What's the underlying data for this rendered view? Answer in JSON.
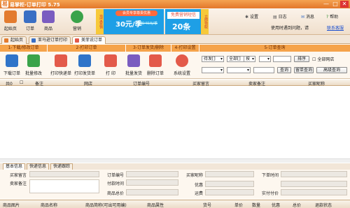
{
  "app": {
    "title": "易掌柜-订单打印 5.75",
    "logo_text": "易"
  },
  "window": {
    "minimize": "—",
    "maximize": "□",
    "close": "✕"
  },
  "topnav": [
    {
      "label": "起始页",
      "color": "#e37b2f"
    },
    {
      "label": "订单",
      "color": "#3a6fc4"
    },
    {
      "label": "商品",
      "color": "#7a5cc0"
    },
    {
      "label": "营销",
      "color": "#3aa34a"
    }
  ],
  "ad1": {
    "badge": "淘宝营销",
    "line1": "会员专享尊贵优惠",
    "price": "30元/季",
    "old": "原价40元/季"
  },
  "ad2": {
    "line1": "免费营销短信",
    "line2": "20条",
    "tag": "立即领取"
  },
  "topright": {
    "settings": "设置",
    "log": "日志",
    "message": "消息",
    "help": "帮助",
    "question": "使用时遇到问题，请",
    "feedback": "联系客服"
  },
  "tabs": [
    {
      "label": "起始页"
    },
    {
      "label": "亚马逊订单打印"
    },
    {
      "label": "美菲说订单"
    }
  ],
  "steps": [
    "1-下载/修改订单",
    "2-打印订单",
    "3-订单发货/删除",
    "4-打印设置",
    "5-订单查询"
  ],
  "actions": [
    {
      "label": "下载订单",
      "color": "#2f74c9"
    },
    {
      "label": "批量修改",
      "color": "#3aa34a"
    },
    {
      "label": "打印快递单",
      "color": "#e35a4a"
    },
    {
      "label": "打印发货单",
      "color": "#2f74c9"
    },
    {
      "label": "打 印",
      "color": "#e35a4a"
    },
    {
      "label": "批量发货",
      "color": "#7a5cc0"
    },
    {
      "label": "删除订单",
      "color": "#e35a4a"
    },
    {
      "label": "系统设置",
      "color": "#e35a4a"
    }
  ],
  "filters": {
    "status": "待发[]",
    "all": "全部[]",
    "by": "按",
    "search_btn": "查询",
    "orderby": "排序",
    "all_stores": "全部网店",
    "local_query": "留单查询",
    "adv_query": "高级查询"
  },
  "grid_headers": [
    "共0",
    "备注",
    "网店",
    "订单编号",
    "买家留言",
    "卖家备注",
    "买家昵称"
  ],
  "detail_tabs": [
    "基本信息",
    "快递信息",
    "快递跟踪"
  ],
  "detail_fields": {
    "buyer_msg": "买家留言",
    "seller_note": "卖家备注",
    "order_no": "订单编号",
    "pay_time": "付款时间",
    "goods_total": "商品总价",
    "buyer_nick": "买家昵称",
    "discount": "优惠",
    "shipping": "运费",
    "order_time": "下单时间",
    "paid": "实付付价"
  },
  "item_headers": [
    "商品图片",
    "商品名称",
    "商品简称(可出可用编)",
    "商品属性",
    "货号",
    "单价",
    "数量",
    "优惠",
    "总价",
    "退款状态"
  ]
}
